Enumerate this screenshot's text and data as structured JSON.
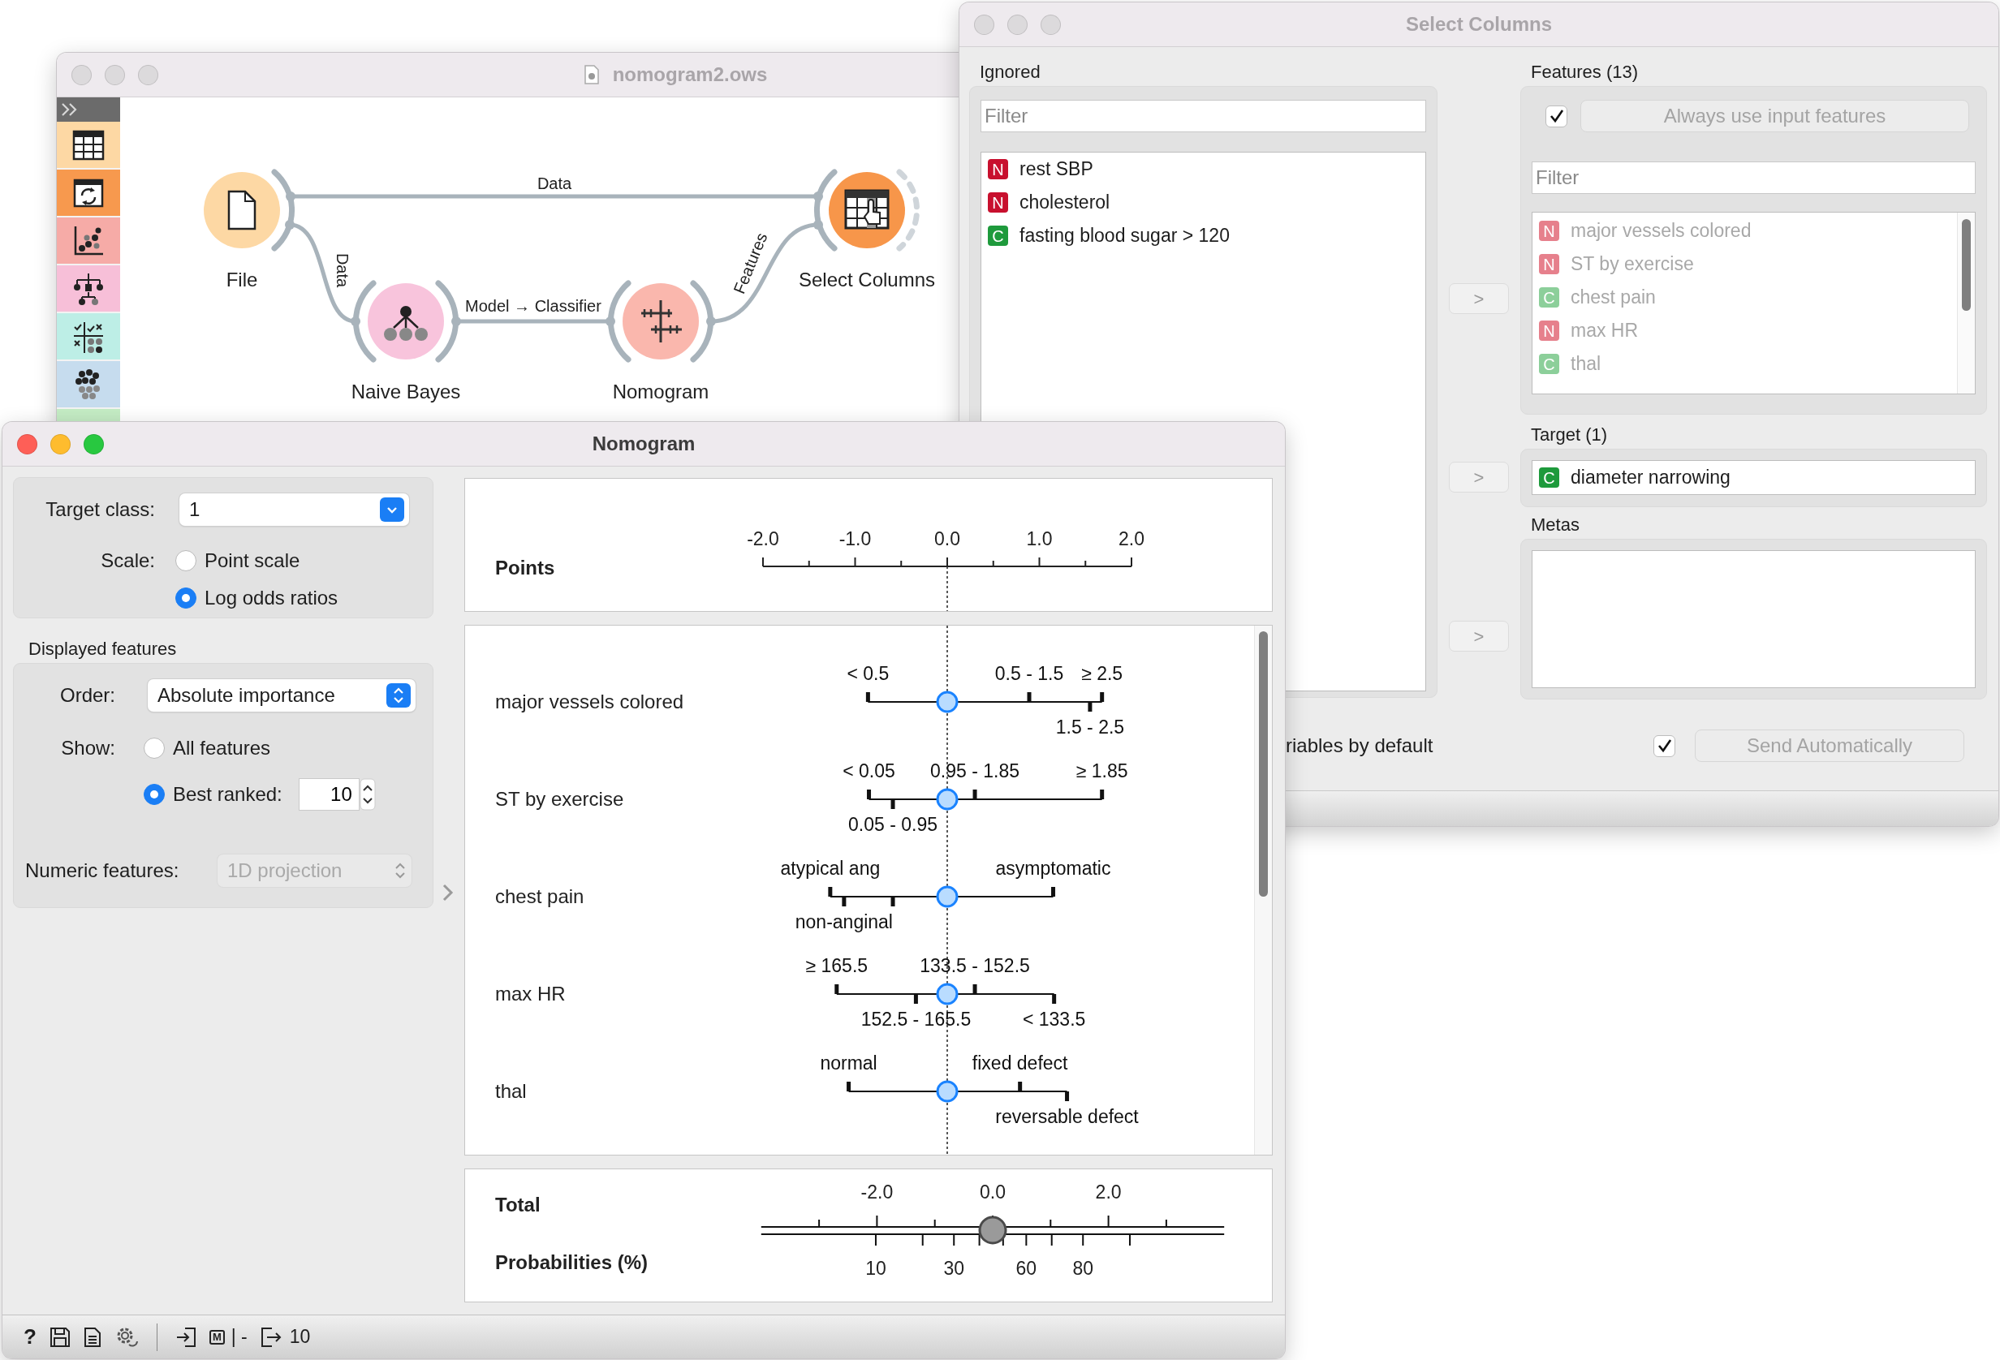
{
  "canvas": {
    "title": "nomogram2.ows",
    "active": false,
    "toolbox": [
      {
        "kind": "table",
        "color": "#fdd8a4"
      },
      {
        "kind": "transform",
        "color": "#f7994e"
      },
      {
        "kind": "scatter",
        "color": "#f6aba7"
      },
      {
        "kind": "tree",
        "color": "#f7bfd8"
      },
      {
        "kind": "evaluate",
        "color": "#bdeee6"
      },
      {
        "kind": "cluster",
        "color": "#c6dcee"
      },
      {
        "kind": "hidden",
        "color": "#c4ecc4"
      }
    ],
    "nodes": [
      {
        "kind": "file",
        "label": "File",
        "color": "#fdd8a4",
        "has_input": false,
        "output_connected": true
      },
      {
        "kind": "select",
        "label": "Select Columns",
        "color": "#f7964a",
        "has_input": true,
        "output_connected": false
      },
      {
        "kind": "bayes",
        "label": "Naive Bayes",
        "color": "#f8c4dc",
        "has_input": true,
        "output_connected": true
      },
      {
        "kind": "nomogram",
        "label": "Nomogram",
        "color": "#fab7ad",
        "has_input": true,
        "output_connected": true
      }
    ],
    "links": [
      {
        "label": "Data"
      },
      {
        "label": "Data"
      },
      {
        "label": "Model → Classifier"
      },
      {
        "label": "Features"
      }
    ]
  },
  "select_columns": {
    "title": "Select Columns",
    "active": false,
    "ignored": {
      "title": "Ignored",
      "filter_placeholder": "Filter",
      "items": [
        {
          "type": "N",
          "name": "rest SBP",
          "color": "#c8102e"
        },
        {
          "type": "N",
          "name": "cholesterol",
          "color": "#c8102e"
        },
        {
          "type": "C",
          "name": "fasting blood sugar > 120",
          "color": "#1e9a3c"
        }
      ]
    },
    "move_buttons": [
      ">",
      ">",
      ">"
    ],
    "features": {
      "title": "Features (13)",
      "always_use_checked": true,
      "always_use_label": "Always use input features",
      "filter_placeholder": "Filter",
      "disabled": true,
      "items": [
        {
          "type": "N",
          "name": "major vessels colored",
          "color": "#e6808c"
        },
        {
          "type": "N",
          "name": "ST by exercise",
          "color": "#e6808c"
        },
        {
          "type": "C",
          "name": "chest pain",
          "color": "#8ccf9a"
        },
        {
          "type": "N",
          "name": "max HR",
          "color": "#e6808c"
        },
        {
          "type": "C",
          "name": "thal",
          "color": "#8ccf9a"
        }
      ]
    },
    "target": {
      "title": "Target (1)",
      "items": [
        {
          "type": "C",
          "name": "diameter narrowing",
          "color": "#1e9a3c"
        }
      ]
    },
    "metas": {
      "title": "Metas"
    },
    "ignore_new_label": "riables by default",
    "send_auto": {
      "checked": true,
      "label": "Send Automatically"
    }
  },
  "nomogram": {
    "title": "Nomogram",
    "active": true,
    "target_class": {
      "label": "Target class:",
      "value": "1"
    },
    "scale": {
      "label": "Scale:",
      "options": [
        {
          "label": "Point scale",
          "selected": false
        },
        {
          "label": "Log odds ratios",
          "selected": true
        }
      ]
    },
    "displayed_features": {
      "title": "Displayed features",
      "order_label": "Order:",
      "order_value": "Absolute importance",
      "show_label": "Show:",
      "show_options": [
        {
          "label": "All features",
          "selected": false
        },
        {
          "label": "Best ranked:",
          "selected": true
        }
      ],
      "best_count": "10",
      "numeric_label": "Numeric features:",
      "numeric_value": "1D projection",
      "numeric_disabled": true
    },
    "points_axis": {
      "title": "Points",
      "ticks": [
        "-2.0",
        "-1.0",
        "0.0",
        "1.0",
        "2.0"
      ]
    },
    "features": [
      {
        "name": "major vessels colored",
        "levels": [
          {
            "label": "< 0.5",
            "kind": "above"
          },
          {
            "label": "0.5 - 1.5",
            "kind": "above"
          },
          {
            "label": "≥ 2.5",
            "kind": "above"
          },
          {
            "label": "1.5 - 2.5",
            "kind": "below"
          }
        ]
      },
      {
        "name": "ST by exercise",
        "levels": [
          {
            "label": "< 0.05",
            "kind": "above"
          },
          {
            "label": "0.95 - 1.85",
            "kind": "above"
          },
          {
            "label": "≥ 1.85",
            "kind": "above"
          },
          {
            "label": "0.05 - 0.95",
            "kind": "below"
          }
        ]
      },
      {
        "name": "chest pain",
        "levels": [
          {
            "label": "atypical ang",
            "kind": "above"
          },
          {
            "label": "asymptomatic",
            "kind": "above"
          },
          {
            "label": "non-anginal",
            "kind": "below"
          },
          {
            "kind": "below"
          }
        ]
      },
      {
        "name": "max HR",
        "levels": [
          {
            "label": "≥ 165.5",
            "kind": "above"
          },
          {
            "label": "133.5 - 152.5",
            "kind": "above"
          },
          {
            "label": "152.5 - 165.5",
            "kind": "below"
          },
          {
            "label": "< 133.5",
            "kind": "below"
          }
        ]
      },
      {
        "name": "thal",
        "levels": [
          {
            "label": "normal",
            "kind": "above"
          },
          {
            "label": "fixed defect",
            "kind": "above"
          },
          {
            "label": "reversable defect",
            "kind": "below"
          }
        ]
      }
    ],
    "total_axis": {
      "title": "Total",
      "ticks": [
        "-2.0",
        "0.0",
        "2.0"
      ]
    },
    "probability_axis": {
      "title": "Probabilities (%)",
      "ticks": [
        "10",
        "30",
        "60",
        "80"
      ]
    },
    "status_bar": {
      "help": "?",
      "input_flag": "M",
      "input_text": "| -",
      "output_count": "10"
    }
  }
}
